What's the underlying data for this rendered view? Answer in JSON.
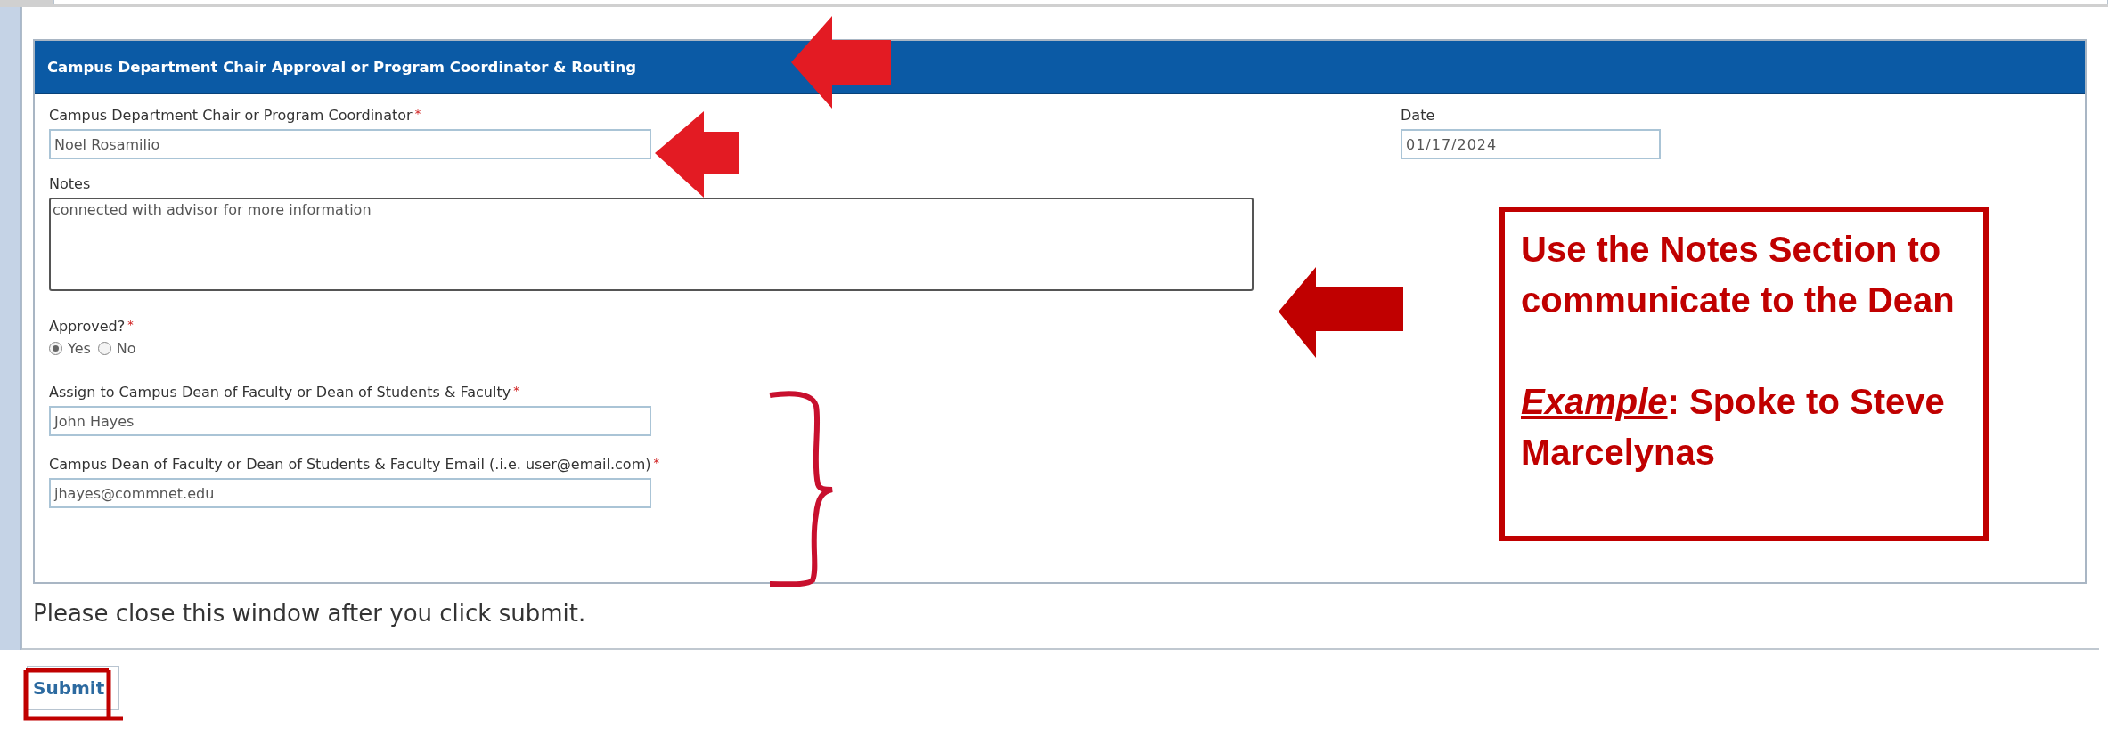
{
  "section": {
    "title": "Campus Department Chair Approval or Program Coordinator & Routing"
  },
  "chair": {
    "label": "Campus Department Chair or Program Coordinator",
    "marker": "*",
    "value": "Noel Rosamilio"
  },
  "date": {
    "label": "Date",
    "value": "01/17/2024"
  },
  "notes": {
    "label": "Notes",
    "value": "connected with advisor for more information"
  },
  "approved": {
    "label": "Approved?",
    "marker": "*",
    "options": [
      {
        "label": "Yes",
        "selected": true
      },
      {
        "label": "No",
        "selected": false
      }
    ]
  },
  "dean": {
    "label": "Assign to Campus Dean of Faculty or Dean of Students & Faculty",
    "marker": "*",
    "value": "John Hayes"
  },
  "dean_email": {
    "label": "Campus Dean of Faculty or Dean of Students & Faculty Email (.i.e. user@email.com)",
    "marker": "*",
    "value": "jhayes@commnet.edu"
  },
  "footer_note": "Please close this window after you click submit.",
  "submit_button": "Submit",
  "callout": {
    "lines": [
      "Use the Notes Section to communicate to the Dean",
      "*Example*:  Spoke to Steve Marcelynas"
    ]
  }
}
